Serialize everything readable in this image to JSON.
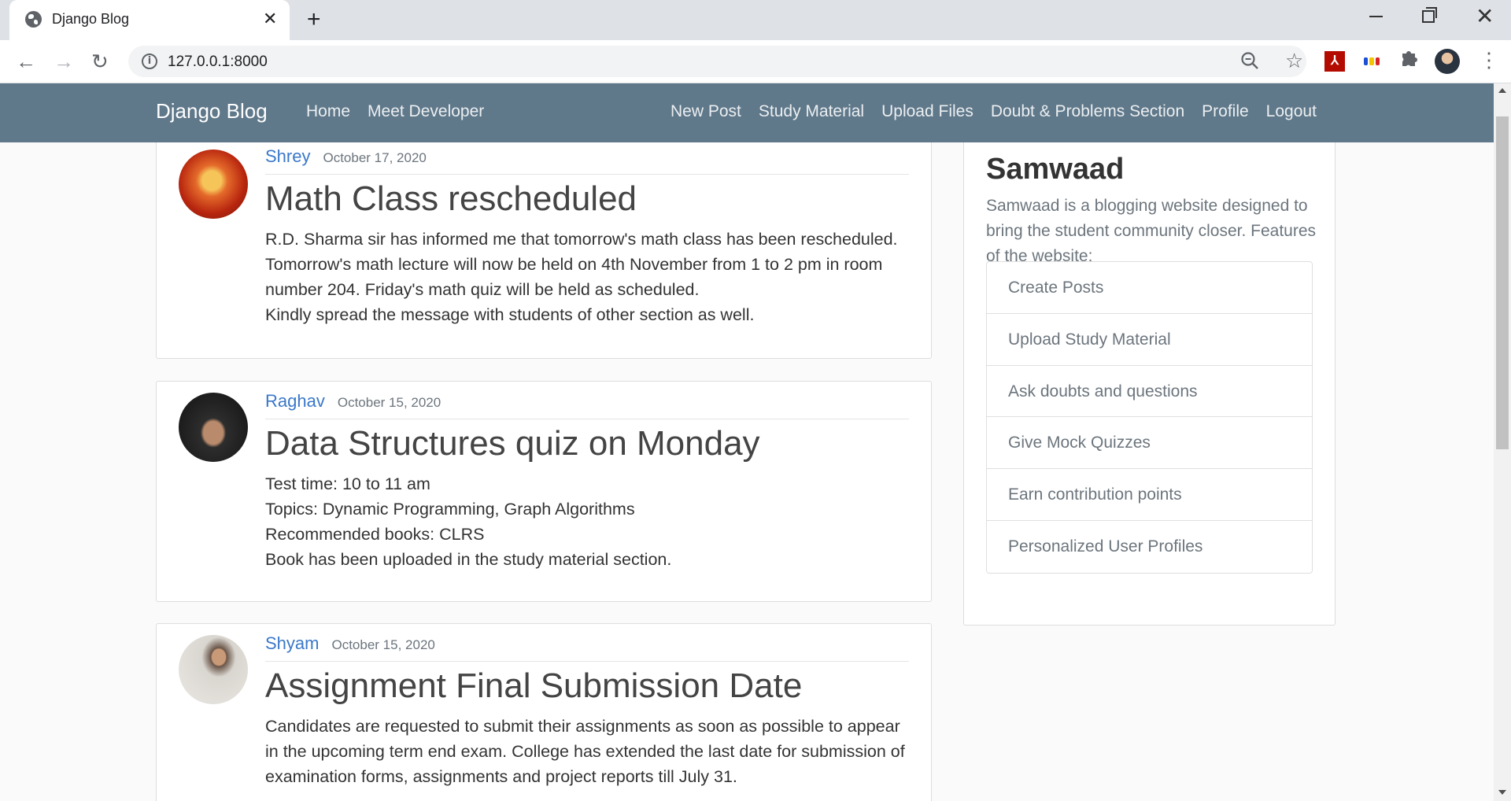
{
  "browser": {
    "tab_title": "Django Blog",
    "url": "127.0.0.1:8000",
    "icons": [
      "globe-icon",
      "close-icon",
      "plus-icon",
      "back-icon",
      "forward-icon",
      "reload-icon",
      "info-icon",
      "zoom-out-icon",
      "star-icon",
      "pdf-extension-icon",
      "flag-extension-icon",
      "puzzle-icon",
      "profile-avatar",
      "menu-icon"
    ]
  },
  "navbar": {
    "brand": "Django Blog",
    "left_links": [
      "Home",
      "Meet Developer"
    ],
    "right_links": [
      "New Post",
      "Study Material",
      "Upload Files",
      "Doubt & Problems Section",
      "Profile",
      "Logout"
    ],
    "background": "#5f788a"
  },
  "posts": [
    {
      "author": "Shrey",
      "date": "October 17, 2020",
      "title": "Math Class rescheduled",
      "body": [
        "R.D. Sharma sir has informed me that tomorrow's math class has been rescheduled.",
        "Tomorrow's math lecture will now be held on 4th November from 1 to 2 pm in room",
        "number 204. Friday's math quiz will be held as scheduled.",
        "Kindly spread the message with students of other section as well."
      ]
    },
    {
      "author": "Raghav",
      "date": "October 15, 2020",
      "title": "Data Structures quiz on Monday",
      "body": [
        "Test time: 10 to 11 am",
        "Topics: Dynamic Programming, Graph Algorithms",
        "Recommended books: CLRS",
        "Book has been uploaded in the study material section."
      ]
    },
    {
      "author": "Shyam",
      "date": "October 15, 2020",
      "title": "Assignment Final Submission Date",
      "body": [
        "Candidates are requested to submit their assignments as soon as possible to appear",
        "in the upcoming term end exam. College has extended the last date for submission of",
        "examination forms, assignments and project reports till July 31."
      ]
    }
  ],
  "sidebar": {
    "title": "Samwaad",
    "description": "Samwaad is a blogging website designed to bring the student community closer. Features of the website:",
    "features": [
      "Create Posts",
      "Upload Study Material",
      "Ask doubts and questions",
      "Give Mock Quizzes",
      "Earn contribution points",
      "Personalized User Profiles"
    ]
  },
  "colors": {
    "link": "#3a78c9",
    "muted": "#6c757d"
  }
}
